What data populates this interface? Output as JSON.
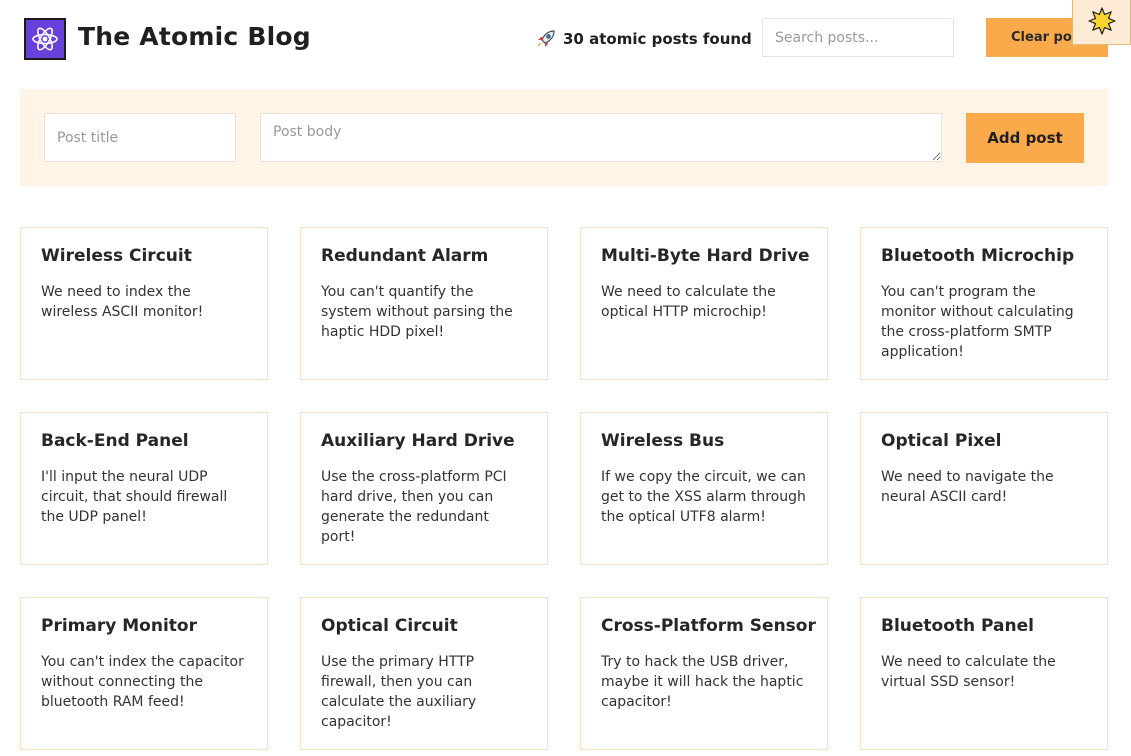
{
  "header": {
    "title": "The Atomic Blog",
    "stats_text": "30 atomic posts found",
    "search_placeholder": "Search posts...",
    "clear_label": "Clear posts",
    "logo_icon": "atom-icon",
    "stats_icon": "rocket-icon",
    "badge_icon": "sun-icon"
  },
  "form": {
    "title_placeholder": "Post title",
    "body_placeholder": "Post body",
    "add_label": "Add post"
  },
  "colors": {
    "accent": "#fbaa4b",
    "form_bg": "#fff4e6",
    "logo_bg": "#6741d9"
  },
  "posts": [
    {
      "title": "Wireless Circuit",
      "body": "We need to index the wireless ASCII monitor!"
    },
    {
      "title": "Redundant Alarm",
      "body": "You can't quantify the system without parsing the haptic HDD pixel!"
    },
    {
      "title": "Multi-Byte Hard Drive",
      "body": "We need to calculate the optical HTTP microchip!"
    },
    {
      "title": "Bluetooth Microchip",
      "body": "You can't program the monitor without calculating the cross-platform SMTP application!"
    },
    {
      "title": "Back-End Panel",
      "body": "I'll input the neural UDP circuit, that should firewall the UDP panel!"
    },
    {
      "title": "Auxiliary Hard Drive",
      "body": "Use the cross-platform PCI hard drive, then you can generate the redundant port!"
    },
    {
      "title": "Wireless Bus",
      "body": "If we copy the circuit, we can get to the XSS alarm through the optical UTF8 alarm!"
    },
    {
      "title": "Optical Pixel",
      "body": "We need to navigate the neural ASCII card!"
    },
    {
      "title": "Primary Monitor",
      "body": "You can't index the capacitor without connecting the bluetooth RAM feed!"
    },
    {
      "title": "Optical Circuit",
      "body": "Use the primary HTTP firewall, then you can calculate the auxiliary capacitor!"
    },
    {
      "title": "Cross-Platform Sensor",
      "body": "Try to hack the USB driver, maybe it will hack the haptic capacitor!"
    },
    {
      "title": "Bluetooth Panel",
      "body": "We need to calculate the virtual SSD sensor!"
    }
  ]
}
